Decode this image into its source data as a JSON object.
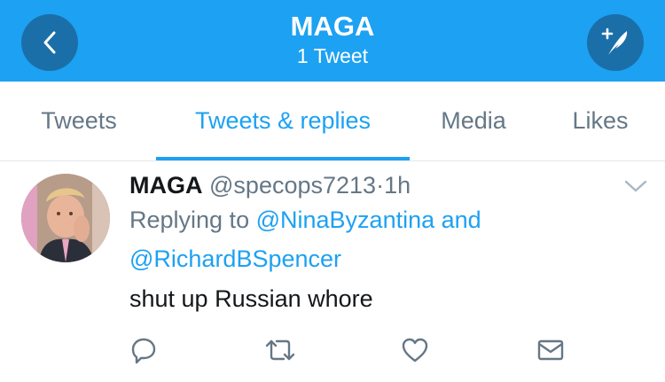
{
  "header": {
    "title": "MAGA",
    "subtitle": "1 Tweet",
    "background_color": "#1da1f2",
    "back_icon": "chevron-left-icon",
    "compose_icon": "compose-tweet-icon"
  },
  "tabs": [
    {
      "label": "Tweets",
      "active": false
    },
    {
      "label": "Tweets & replies",
      "active": true
    },
    {
      "label": "Media",
      "active": false
    },
    {
      "label": "Likes",
      "active": false
    }
  ],
  "tweet": {
    "display_name": "MAGA",
    "handle": "@specops7213",
    "separator": "·",
    "time": "1h",
    "replying_prefix": "Replying to",
    "mentions": [
      "@NinaByzantina",
      "@RichardBSpencer"
    ],
    "mention_joiner": "and",
    "text": "shut up Russian whore",
    "accent_color": "#1da1f2",
    "actions": [
      {
        "name": "reply",
        "icon": "reply-icon"
      },
      {
        "name": "retweet",
        "icon": "retweet-icon"
      },
      {
        "name": "like",
        "icon": "heart-icon"
      },
      {
        "name": "message",
        "icon": "envelope-icon"
      }
    ]
  }
}
